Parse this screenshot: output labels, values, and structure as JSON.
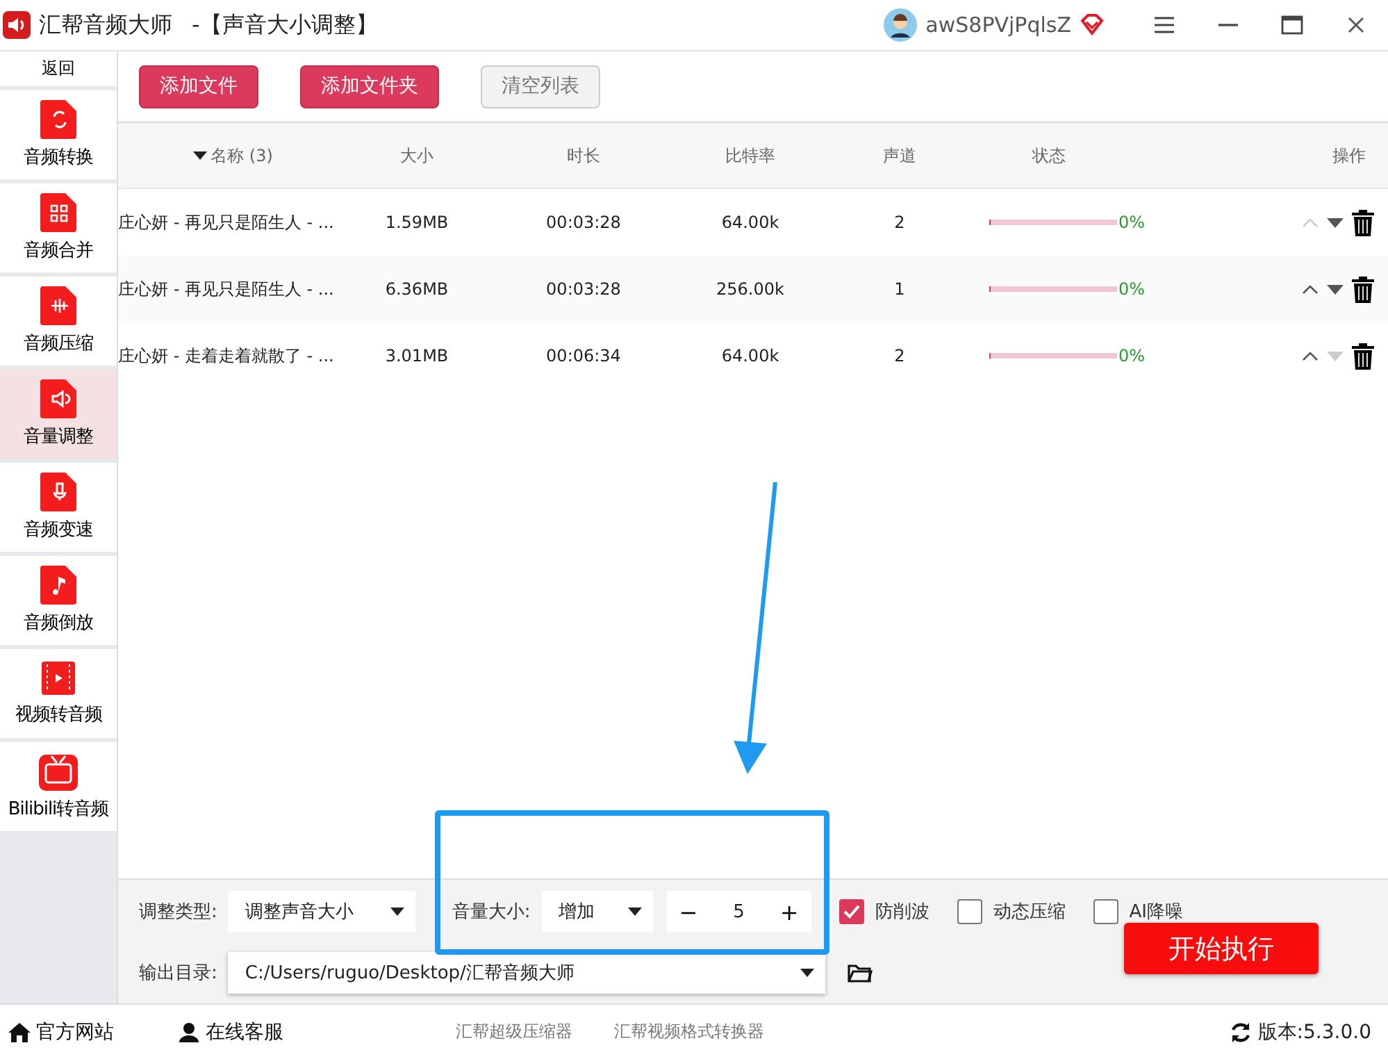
{
  "window": {
    "app_name": "汇帮音频大师",
    "title": "-【声音大小调整】",
    "username": "awS8PVjPqlsZ"
  },
  "sidebar": {
    "back": "返回",
    "items": [
      {
        "kind": "convert",
        "label": "音频转换",
        "selected": false
      },
      {
        "kind": "merge",
        "label": "音频合并",
        "selected": false
      },
      {
        "kind": "compress",
        "label": "音频压缩",
        "selected": false
      },
      {
        "kind": "volume",
        "label": "音量调整",
        "selected": true
      },
      {
        "kind": "speed",
        "label": "音频变速",
        "selected": false
      },
      {
        "kind": "reverse",
        "label": "音频倒放",
        "selected": false
      },
      {
        "kind": "video",
        "label": "视频转音频",
        "selected": false
      },
      {
        "kind": "tv",
        "label": "Bilibili转音频",
        "selected": false
      }
    ]
  },
  "toolbar": [
    {
      "label": "添加文件",
      "disabled": false
    },
    {
      "label": "添加文件夹",
      "disabled": false
    },
    {
      "label": "清空列表",
      "disabled": true
    }
  ],
  "table": {
    "columns": [
      "名称 (3)",
      "大小",
      "时长",
      "比特率",
      "声道",
      "状态",
      "操作"
    ],
    "rows": [
      {
        "name": "庄心妍 - 再见只是陌生人 - ...",
        "size": "1.59MB",
        "duration": "00:03:28",
        "bitrate": "64.00k",
        "channels": "2",
        "level": 0,
        "percent": "0%",
        "move_up_disabled": true,
        "move_down_disabled": false
      },
      {
        "name": "庄心妍 - 再见只是陌生人 - ...",
        "size": "6.36MB",
        "duration": "00:03:28",
        "bitrate": "256.00k",
        "channels": "1",
        "level": 0,
        "percent": "0%",
        "move_up_disabled": false,
        "move_down_disabled": false
      },
      {
        "name": "庄心妍 - 走着走着就散了 - ...",
        "size": "3.01MB",
        "duration": "00:06:34",
        "bitrate": "64.00k",
        "channels": "2",
        "level": 0,
        "percent": "0%",
        "move_up_disabled": false,
        "move_down_disabled": true
      }
    ]
  },
  "settings": {
    "type_label": "调整类型:",
    "type_value": "调整声音大小",
    "volume_label": "音量大小:",
    "volume_mode": "增加",
    "volume_minus": "−",
    "volume_value": "5",
    "volume_plus": "+",
    "options": [
      {
        "label": "防削波",
        "checked": true
      },
      {
        "label": "动态压缩",
        "checked": false
      },
      {
        "label": "AI降噪",
        "checked": false
      }
    ],
    "output_label": "输出目录:",
    "output_path": "C:/Users/ruguo/Desktop/汇帮音频大师",
    "start": "开始执行"
  },
  "status_bar": {
    "links": [
      "官方网站",
      "在线客服"
    ],
    "products": [
      "汇帮超级压缩器",
      "汇帮视频格式转换器"
    ],
    "version": "版本:5.3.0.0"
  }
}
